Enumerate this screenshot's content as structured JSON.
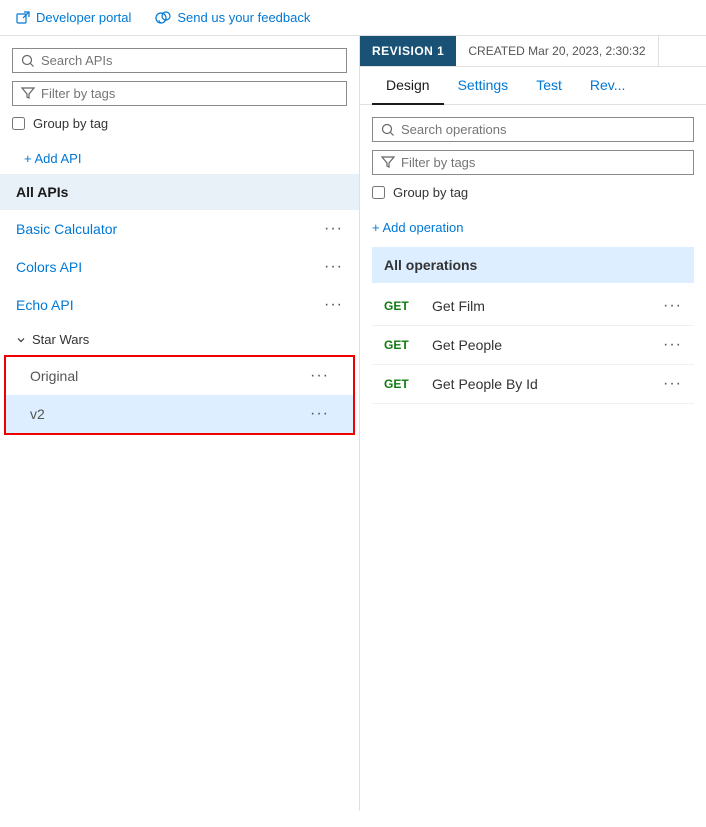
{
  "topbar": {
    "developer_portal_label": "Developer portal",
    "feedback_label": "Send us your feedback"
  },
  "left_panel": {
    "search_apis_placeholder": "Search APIs",
    "filter_by_tags_placeholder": "Filter by tags",
    "group_by_tag_label": "Group by tag",
    "add_api_label": "+ Add API",
    "all_apis_label": "All APIs",
    "apis": [
      {
        "name": "Basic Calculator",
        "dots": "···"
      },
      {
        "name": "Colors API",
        "dots": "···"
      },
      {
        "name": "Echo API",
        "dots": "···"
      }
    ],
    "star_wars_group": "Star Wars",
    "sub_items": [
      {
        "name": "Original",
        "dots": "···"
      },
      {
        "name": "v2",
        "dots": "···"
      }
    ]
  },
  "right_panel": {
    "revision_badge": "REVISION 1",
    "created_label": "CREATED Mar 20, 2023, 2:30:32",
    "tabs": [
      {
        "label": "Design",
        "active": true
      },
      {
        "label": "Settings",
        "active": false
      },
      {
        "label": "Test",
        "active": false
      },
      {
        "label": "Rev...",
        "active": false
      }
    ],
    "search_operations_placeholder": "Search operations",
    "filter_by_tags_placeholder": "Filter by tags",
    "group_by_tag_label": "Group by tag",
    "add_operation_label": "+ Add operation",
    "all_operations_label": "All operations",
    "operations": [
      {
        "method": "GET",
        "name": "Get Film",
        "dots": "···"
      },
      {
        "method": "GET",
        "name": "Get People",
        "dots": "···"
      },
      {
        "method": "GET",
        "name": "Get People By Id",
        "dots": "···"
      }
    ]
  }
}
